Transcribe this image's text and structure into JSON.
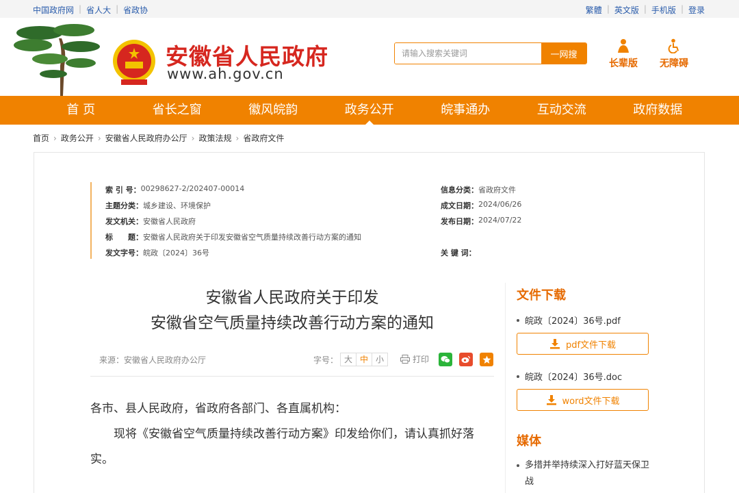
{
  "topbar": {
    "left_links": [
      "中国政府网",
      "省人大",
      "省政协"
    ],
    "right_links": [
      "繁體",
      "英文版",
      "手机版",
      "登录"
    ]
  },
  "header": {
    "site_title": "安徽省人民政府",
    "site_url": "www.ah.gov.cn",
    "search_placeholder": "请输入搜索关键词",
    "search_button": "一网搜",
    "tool_elder": "长辈版",
    "tool_accessible": "无障碍"
  },
  "nav": {
    "items": [
      "首 页",
      "省长之窗",
      "徽风皖韵",
      "政务公开",
      "皖事通办",
      "互动交流",
      "政府数据"
    ],
    "active_index": 3
  },
  "breadcrumb": [
    "首页",
    "政务公开",
    "安徽省人民政府办公厅",
    "政策法规",
    "省政府文件"
  ],
  "meta": {
    "index_label": "索 引 号：",
    "index_value": "00298627-2/202407-00014",
    "category_label": "信息分类：",
    "category_value": "省政府文件",
    "topic_label": "主题分类：",
    "topic_value": "城乡建设、环境保护",
    "date_written_label": "成文日期：",
    "date_written_value": "2024/06/26",
    "issuer_label": "发文机关：",
    "issuer_value": "安徽省人民政府",
    "date_published_label": "发布日期：",
    "date_published_value": "2024/07/22",
    "title_label": "标　　题：",
    "title_value": "安徽省人民政府关于印发安徽省空气质量持续改善行动方案的通知",
    "doc_no_label": "发文字号：",
    "doc_no_value": "皖政〔2024〕36号",
    "keywords_label": "关 键 词：",
    "keywords_value": ""
  },
  "article": {
    "title_line1": "安徽省人民政府关于印发",
    "title_line2": "安徽省空气质量持续改善行动方案的通知",
    "source": "来源：安徽省人民政府办公厅",
    "font_label": "字号：",
    "font_large": "大",
    "font_medium": "中",
    "font_small": "小",
    "print": "打印",
    "para1": "各市、县人民政府，省政府各部门、各直属机构：",
    "para2": "现将《安徽省空气质量持续改善行动方案》印发给你们，请认真抓好落实。"
  },
  "sidebar": {
    "download_heading": "文件下载",
    "file1": "皖政〔2024〕36号.pdf",
    "pdf_button": "pdf文件下载",
    "file2": "皖政〔2024〕36号.doc",
    "word_button": "word文件下载",
    "media_heading": "媒体",
    "media_item": "多措并举持续深入打好蓝天保卫战"
  },
  "colors": {
    "brand_orange": "#f08200",
    "title_red": "#d6271f",
    "link_blue": "#2a5cab"
  }
}
